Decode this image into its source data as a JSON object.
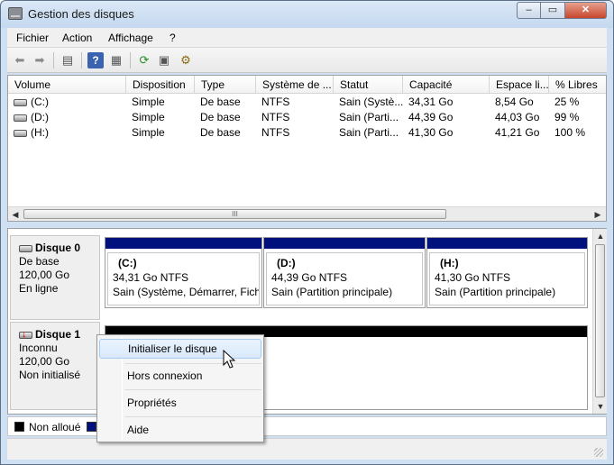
{
  "window": {
    "title": "Gestion des disques",
    "controls": {
      "minimize": "–",
      "maximize": "▭",
      "close": "✕"
    }
  },
  "menu": {
    "items": [
      "Fichier",
      "Action",
      "Affichage",
      "?"
    ]
  },
  "toolbar": {
    "buttons": [
      "back-icon",
      "forward-icon",
      "console-tree-icon",
      "help-icon",
      "show-hide-icon",
      "refresh-icon",
      "properties-icon",
      "settings-icon"
    ]
  },
  "volume_list": {
    "columns": [
      "Volume",
      "Disposition",
      "Type",
      "Système de ...",
      "Statut",
      "Capacité",
      "Espace li...",
      "% Libres"
    ],
    "rows": [
      [
        "(C:)",
        "Simple",
        "De base",
        "NTFS",
        "Sain (Systè...",
        "34,31 Go",
        "8,54 Go",
        "25 %"
      ],
      [
        "(D:)",
        "Simple",
        "De base",
        "NTFS",
        "Sain (Parti...",
        "44,39 Go",
        "44,03 Go",
        "99 %"
      ],
      [
        "(H:)",
        "Simple",
        "De base",
        "NTFS",
        "Sain (Parti...",
        "41,30 Go",
        "41,21 Go",
        "100 %"
      ]
    ],
    "hscroll_grip": "III"
  },
  "disks": [
    {
      "name": "Disque 0",
      "kind": "De base",
      "size": "120,00 Go",
      "state": "En ligne",
      "partitions": [
        {
          "name": "(C:)",
          "size": "34,31 Go NTFS",
          "status": "Sain (Système, Démarrer, Fichi"
        },
        {
          "name": "(D:)",
          "size": "44,39 Go NTFS",
          "status": "Sain (Partition principale)"
        },
        {
          "name": "(H:)",
          "size": "41,30 Go NTFS",
          "status": "Sain (Partition principale)"
        }
      ]
    },
    {
      "name": "Disque 1",
      "kind": "Inconnu",
      "size": "120,00 Go",
      "state": "Non initialisé"
    }
  ],
  "legend": {
    "items": [
      {
        "label": "Non alloué",
        "color": "#000000"
      },
      {
        "label": "",
        "color": "#00117e"
      }
    ]
  },
  "context_menu": {
    "items": [
      "Initialiser le disque",
      "Hors connexion",
      "Propriétés",
      "Aide"
    ],
    "highlighted": 0
  },
  "colors": {
    "primary_partition": "#00117e",
    "unallocated": "#000000",
    "menu_highlight": "#d9e9fb"
  }
}
